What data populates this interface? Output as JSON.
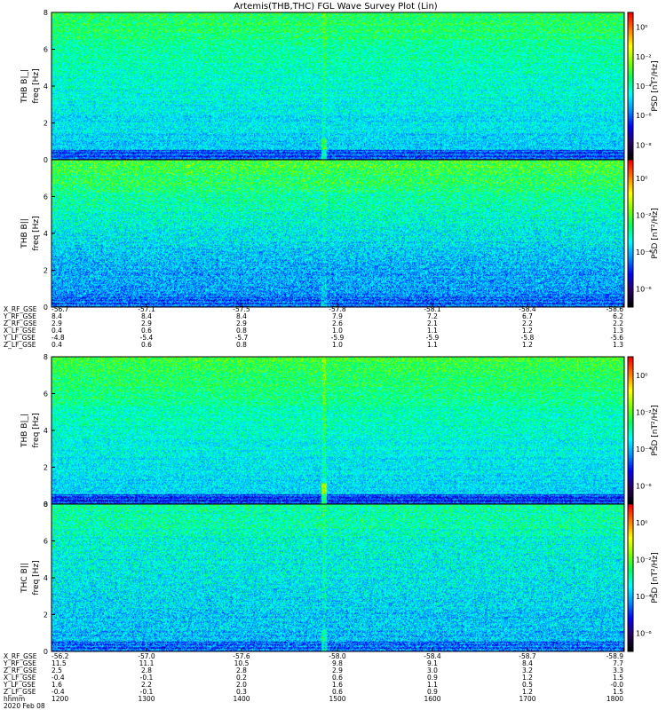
{
  "title": "Artemis(THB,THC) FGL Wave Survey Plot (Lin)",
  "colors": {
    "spectrum": [
      "#000000",
      "#2a0060",
      "#0000ff",
      "#0090ff",
      "#00ffff",
      "#00ff60",
      "#80ff00",
      "#ffff00",
      "#ff8000",
      "#ff0000"
    ],
    "background": "#ffffff",
    "axis": "#000000"
  },
  "chart_data": [
    {
      "type": "heatmap",
      "ylabel": "THB B|_|",
      "ylabel2": "freq [Hz]",
      "yticks": [
        "0",
        "2",
        "4",
        "6",
        "8"
      ],
      "ylim": [
        0,
        8
      ],
      "colorbar_label": "PSD [nT²/Hz]",
      "colorbar_ticks": [
        "10⁻⁸",
        "10⁻⁶",
        "10⁻⁴",
        "10⁻²",
        "10⁰"
      ],
      "profile": {
        "high": 0.58,
        "low": 0.4,
        "bottom_band": 0.28
      },
      "spike": {
        "x": 0.475,
        "strength": 0.18
      },
      "noise": 0.1
    },
    {
      "type": "heatmap",
      "ylabel": "THB B||",
      "ylabel2": "freq [Hz]",
      "yticks": [
        "0",
        "2",
        "4",
        "6"
      ],
      "ylim": [
        0,
        8
      ],
      "colorbar_label": "PSD [nT²/Hz]",
      "colorbar_ticks": [
        "10⁻⁶",
        "10⁻⁴",
        "10⁻²",
        "10⁰"
      ],
      "profile": {
        "high": 0.62,
        "low": 0.33,
        "bottom_band": 0.3
      },
      "spike": {
        "x": 0.475,
        "strength": 0.08
      },
      "noise": 0.12
    },
    {
      "type": "heatmap",
      "ylabel": "THB B|_|",
      "ylabel2": "freq [Hz]",
      "yticks": [
        "0",
        "2",
        "4",
        "6",
        "8"
      ],
      "ylim": [
        0,
        8
      ],
      "colorbar_label": "PSD [nT²/Hz]",
      "colorbar_ticks": [
        "10⁻⁶",
        "10⁻⁴",
        "10⁻²",
        "10⁰"
      ],
      "profile": {
        "high": 0.6,
        "low": 0.4,
        "bottom_band": 0.26
      },
      "spike": {
        "x": 0.475,
        "strength": 0.28
      },
      "noise": 0.1
    },
    {
      "type": "heatmap",
      "ylabel": "THC B||",
      "ylabel2": "freq [Hz]",
      "yticks": [
        "0",
        "2",
        "4",
        "6",
        "8"
      ],
      "ylim": [
        0,
        8
      ],
      "colorbar_label": "PSD [nT²/Hz]",
      "colorbar_ticks": [
        "10⁻⁶",
        "10⁻⁴",
        "10⁻²",
        "10⁰"
      ],
      "profile": {
        "high": 0.52,
        "low": 0.38,
        "bottom_band": 0.3
      },
      "spike": {
        "x": 0.475,
        "strength": 0.14
      },
      "noise": 0.12
    }
  ],
  "orbit_tables": [
    {
      "rows": [
        {
          "label": "X_RF_GSE",
          "values": [
            "-56.7",
            "-57.1",
            "-57.5",
            "-57.8",
            "-58.1",
            "-58.4",
            "-58.6"
          ]
        },
        {
          "label": "Y_RF_GSE",
          "values": [
            "8.4",
            "8.4",
            "8.4",
            "7.9",
            "7.2",
            "6.7",
            "6.2"
          ]
        },
        {
          "label": "Z_RF_GSE",
          "values": [
            "2.9",
            "2.9",
            "2.9",
            "2.6",
            "2.1",
            "2.2",
            "2.2"
          ]
        },
        {
          "label": "X_LF_GSE",
          "values": [
            "0.4",
            "0.6",
            "0.8",
            "1.0",
            "1.1",
            "1.2",
            "1.3"
          ]
        },
        {
          "label": "Y_LF_GSE",
          "values": [
            "-4.8",
            "-5.4",
            "-5.7",
            "-5.9",
            "-5.9",
            "-5.8",
            "-5.6"
          ]
        },
        {
          "label": "Z_LF_GSE",
          "values": [
            "0.4",
            "0.6",
            "0.8",
            "1.0",
            "1.1",
            "1.2",
            "1.3"
          ]
        }
      ]
    },
    {
      "rows": [
        {
          "label": "X_RF_GSE",
          "values": [
            "-56.2",
            "-57.0",
            "-57.6",
            "-58.0",
            "-58.4",
            "-58.7",
            "-58.9"
          ]
        },
        {
          "label": "Y_RF_GSE",
          "values": [
            "11.5",
            "11.1",
            "10.5",
            "9.8",
            "9.1",
            "8.4",
            "7.7"
          ]
        },
        {
          "label": "Z_RF_GSE",
          "values": [
            "2.5",
            "2.8",
            "2.8",
            "2.9",
            "3.0",
            "3.2",
            "3.3"
          ]
        },
        {
          "label": "X_LF_GSE",
          "values": [
            "-0.4",
            "-0.1",
            "0.2",
            "0.6",
            "0.9",
            "1.2",
            "1.5"
          ]
        },
        {
          "label": "Y_LF_GSE",
          "values": [
            "1.6",
            "2.2",
            "2.0",
            "1.6",
            "1.1",
            "0.5",
            "-0.0"
          ]
        },
        {
          "label": "Z_LF_GSE",
          "values": [
            "-0.4",
            "-0.1",
            "0.3",
            "0.6",
            "0.9",
            "1.2",
            "1.5"
          ]
        }
      ],
      "time_row": {
        "label": "hhmm",
        "values": [
          "1200",
          "1300",
          "1400",
          "1500",
          "1600",
          "1700",
          "1800"
        ]
      },
      "date": "2020 Feb 08"
    }
  ]
}
